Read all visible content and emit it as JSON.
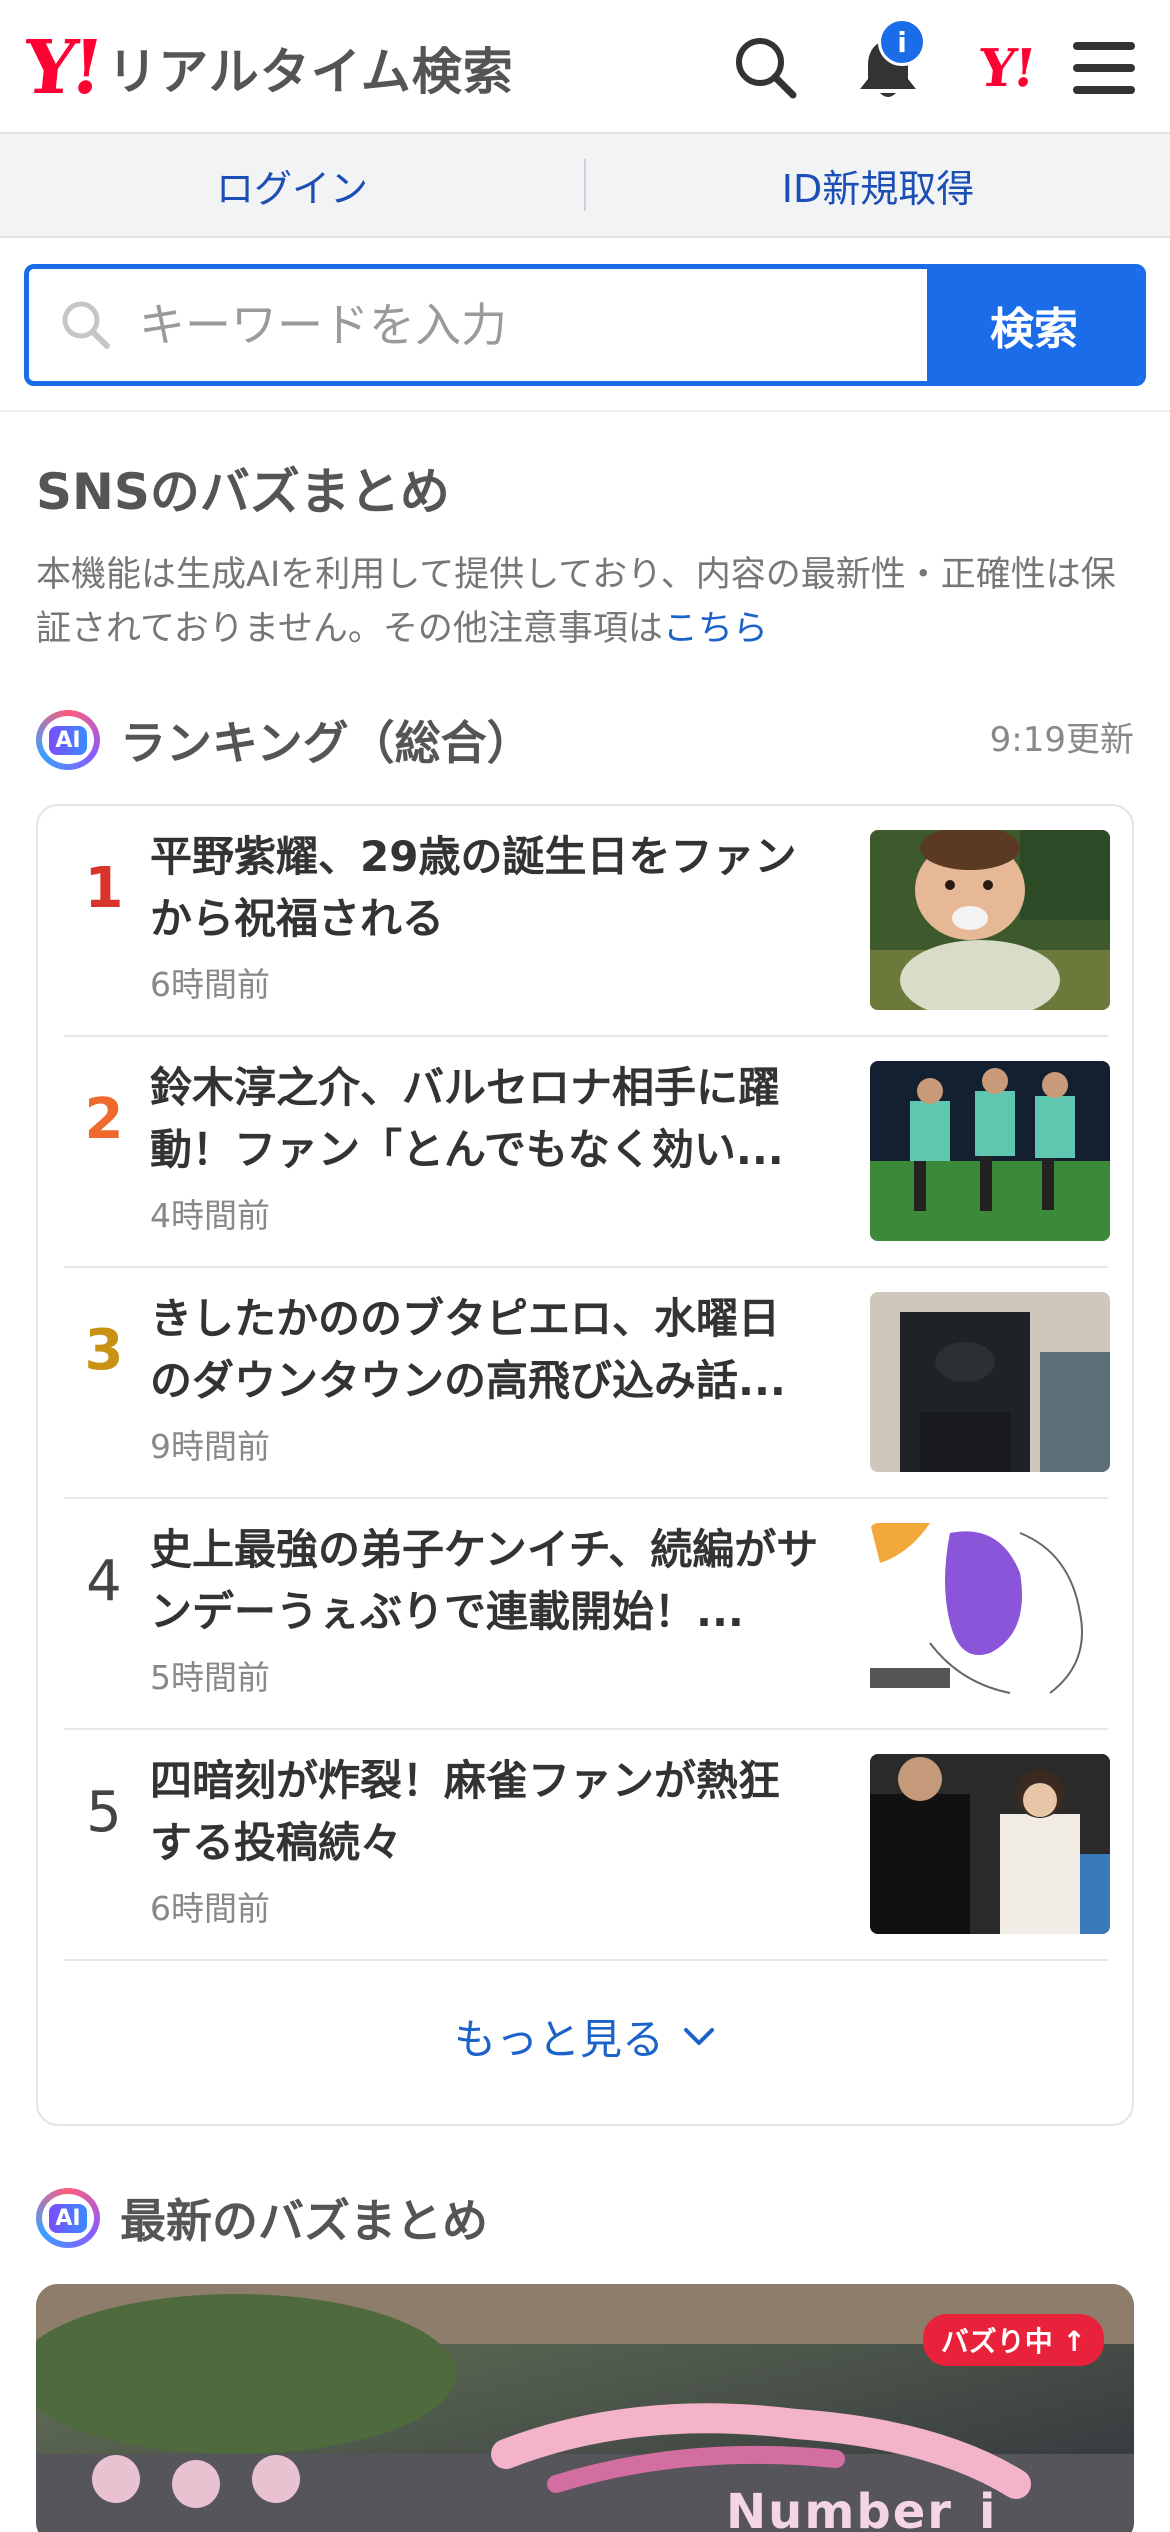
{
  "header": {
    "logo_y": "Y!",
    "logo_text": "リアルタイム検索",
    "badge": "i",
    "y_brand": "Y!"
  },
  "loginbar": {
    "login": "ログイン",
    "signup": "ID新規取得"
  },
  "search": {
    "placeholder": "キーワードを入力",
    "button": "検索"
  },
  "sns": {
    "title": "SNSのバズまとめ",
    "notice": "本機能は生成AIを利用して提供しており、内容の最新性・正確性は保証されておりません。その他注意事項は",
    "notice_link": "こちら"
  },
  "ranking": {
    "ai_label": "AI",
    "title": "ランキング（総合）",
    "updated": "9:19更新",
    "items": [
      {
        "rank": "1",
        "headline": "平野紫耀、29歳の誕生日をファンから祝福される",
        "time": "6時間前",
        "rank_color": "#d9342b"
      },
      {
        "rank": "2",
        "headline": "鈴木淳之介、バルセロナ相手に躍動！ファン「とんでもなく効い...",
        "time": "4時間前",
        "rank_color": "#ef6a2c"
      },
      {
        "rank": "3",
        "headline": "きしたかののブタピエロ、水曜日のダウンタウンの高飛び込み話...",
        "time": "9時間前",
        "rank_color": "#c89213"
      },
      {
        "rank": "4",
        "headline": "史上最強の弟子ケンイチ、続編がサンデーうぇぶりで連載開始！...",
        "time": "5時間前",
        "rank_color": "#444444"
      },
      {
        "rank": "5",
        "headline": "四暗刻が炸裂！麻雀ファンが熱狂する投稿続々",
        "time": "6時間前",
        "rank_color": "#444444"
      }
    ],
    "more": "もっと見る"
  },
  "latest": {
    "ai_label": "AI",
    "title": "最新のバズまとめ",
    "buzz_badge": "バズり中",
    "image_caption": "Number_i"
  }
}
